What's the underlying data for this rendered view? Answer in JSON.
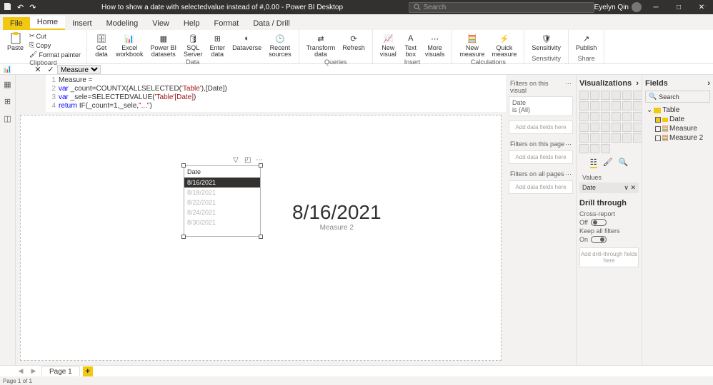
{
  "titlebar": {
    "title": "How to show a date with selectedvalue instead of #,0.00 - Power BI Desktop",
    "search_placeholder": "Search",
    "user_name": "Eyelyn Qin"
  },
  "tabs": {
    "file": "File",
    "items": [
      "Home",
      "Insert",
      "Modeling",
      "View",
      "Help",
      "Format",
      "Data / Drill"
    ],
    "active_index": 0
  },
  "ribbon": {
    "clipboard": {
      "paste": "Paste",
      "cut": "Cut",
      "copy": "Copy",
      "format_painter": "Format painter",
      "label": "Clipboard"
    },
    "data": {
      "get_data": "Get\ndata",
      "excel": "Excel\nworkbook",
      "pbi_datasets": "Power BI\ndatasets",
      "sql": "SQL\nServer",
      "enter": "Enter\ndata",
      "dataverse": "Dataverse",
      "recent": "Recent\nsources",
      "label": "Data"
    },
    "queries": {
      "transform": "Transform\ndata",
      "refresh": "Refresh",
      "label": "Queries"
    },
    "insert": {
      "new_visual": "New\nvisual",
      "text_box": "Text\nbox",
      "more": "More\nvisuals",
      "label": "Insert"
    },
    "calc": {
      "new_measure": "New\nmeasure",
      "quick_measure": "Quick\nmeasure",
      "label": "Calculations"
    },
    "sens": {
      "btn": "Sensitivity",
      "label": "Sensitivity"
    },
    "share": {
      "publish": "Publish",
      "label": "Share"
    }
  },
  "formula": {
    "name": "Measure"
  },
  "code": {
    "l1": {
      "n": "1",
      "a": "Measure ="
    },
    "l2": {
      "n": "2",
      "a": "var ",
      "b": "_count",
      "c": "=COUNTX(ALLSELECTED(",
      "d": "'Table'",
      "e": "),[Date])"
    },
    "l3": {
      "n": "3",
      "a": "var ",
      "b": "_sele",
      "c": "=SELECTEDVALUE(",
      "d": "'Table'[Date]",
      "e": ")"
    },
    "l4": {
      "n": "4",
      "a": "return ",
      "b": "IF(",
      "c": "_count",
      "d": "=1,",
      "e": "_sele",
      "f": ",",
      "g": "\"...\"",
      "h": ")"
    }
  },
  "slicer": {
    "title": "Date",
    "items": [
      "8/16/2021",
      "8/18/2021",
      "8/22/2021",
      "8/24/2021",
      "8/30/2021"
    ],
    "selected_index": 0
  },
  "card": {
    "value": "8/16/2021",
    "category": "Measure 2"
  },
  "filters": {
    "visual_head": "Filters on this visual",
    "date_label": "Date",
    "date_state": "is (All)",
    "add": "Add data fields here",
    "page_head": "Filters on this page",
    "all_head": "Filters on all pages"
  },
  "viz": {
    "title": "Visualizations",
    "values_label": "Values",
    "value_field": "Date",
    "drill_title": "Drill through",
    "cross_report": "Cross-report",
    "off": "Off",
    "keep_all": "Keep all filters",
    "on": "On",
    "add_drill": "Add drill-through fields here"
  },
  "fields": {
    "title": "Fields",
    "search": "Search",
    "table": "Table",
    "date": "Date",
    "measure": "Measure",
    "measure2": "Measure 2"
  },
  "page": {
    "name": "Page 1",
    "status": "Page 1 of 1"
  }
}
